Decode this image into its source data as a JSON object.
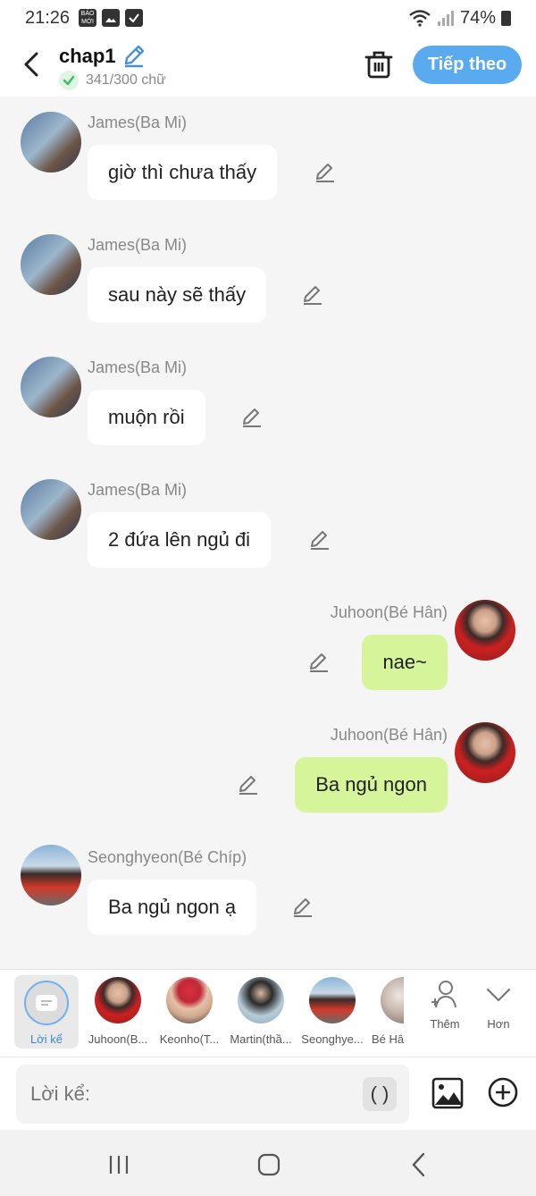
{
  "status": {
    "time": "21:26",
    "battery": "74%",
    "news_icon_text": "BÁO MỚI"
  },
  "header": {
    "title": "chap1",
    "word_count": "341/300 chữ",
    "next_label": "Tiếp theo"
  },
  "messages": [
    {
      "sender": "James(Ba Mi)",
      "text": "giờ thì chưa thấy",
      "side": "left"
    },
    {
      "sender": "James(Ba Mi)",
      "text": "sau này sẽ thấy",
      "side": "left"
    },
    {
      "sender": "James(Ba Mi)",
      "text": "muộn rồi",
      "side": "left"
    },
    {
      "sender": "James(Ba Mi)",
      "text": "2 đứa lên ngủ đi",
      "side": "left"
    },
    {
      "sender": "Juhoon(Bé Hân)",
      "text": "nae~",
      "side": "right"
    },
    {
      "sender": "Juhoon(Bé Hân)",
      "text": "Ba ngủ ngon",
      "side": "right"
    },
    {
      "sender": "Seonghyeon(Bé Chíp)",
      "text": "Ba ngủ ngon ạ",
      "side": "left"
    }
  ],
  "characters": {
    "narration": "Lời kể",
    "items": [
      "Juhoon(B...",
      "Keonho(T...",
      "Martin(thầ...",
      "Seonghye...",
      "Bé Hâ"
    ],
    "add_label": "Thêm",
    "more_label": "Hơn"
  },
  "input": {
    "placeholder": "Lời kể:",
    "paren": "( )"
  },
  "colors": {
    "accent": "#5aaaf0",
    "my_bubble": "#d6f59a",
    "check": "#3dbb63"
  }
}
